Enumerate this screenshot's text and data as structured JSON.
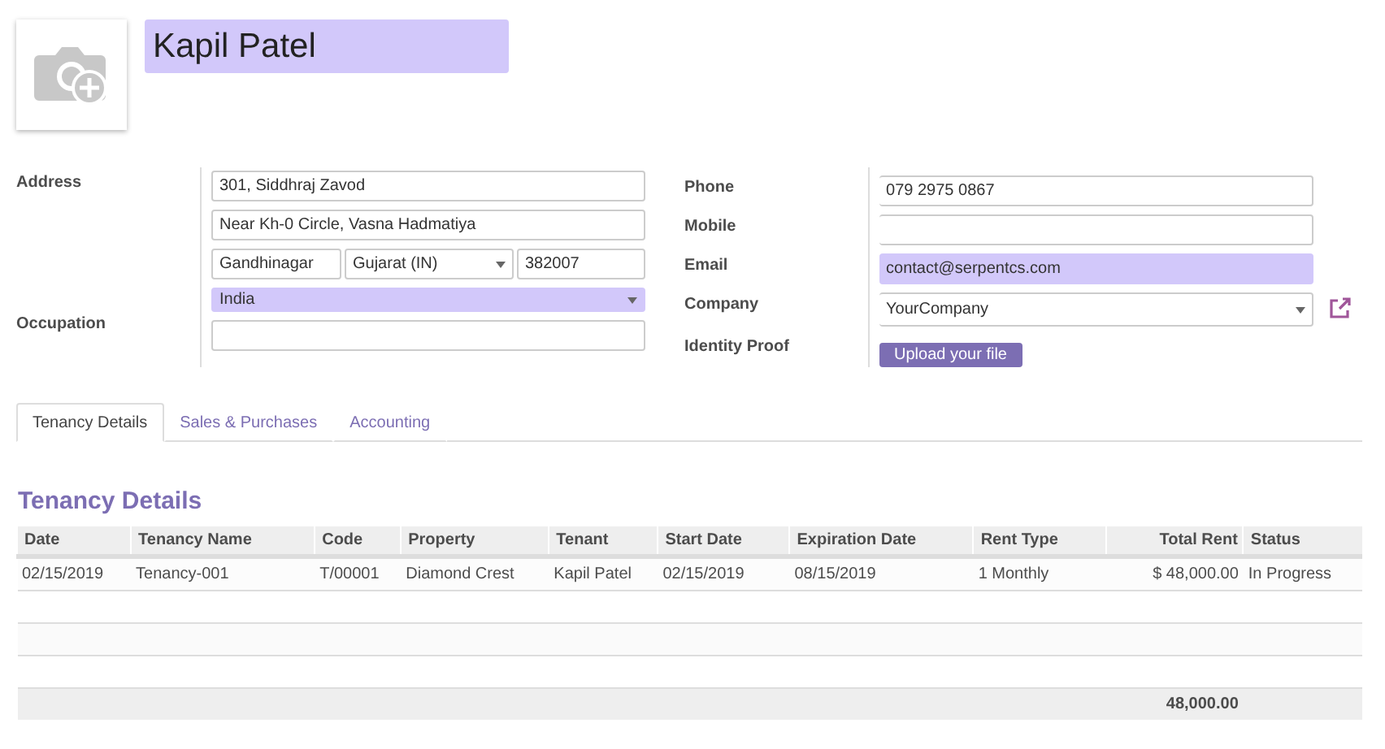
{
  "name_field": {
    "value": "Kapil Patel",
    "required": true
  },
  "left_group": {
    "address": {
      "label": "Address",
      "street": {
        "value": "301, Siddhraj Zavod",
        "required": false
      },
      "street2": {
        "value": "Near Kh-0 Circle, Vasna Hadmatiya",
        "required": false
      },
      "city": {
        "value": "Gandhinagar",
        "required": false
      },
      "state": {
        "value": "Gujarat (IN)",
        "required": false
      },
      "zip": {
        "value": "382007",
        "required": false
      },
      "country": {
        "value": "India",
        "required": true
      }
    },
    "occupation": {
      "label": "Occupation",
      "required": false
    }
  },
  "right_group": [
    {
      "kind": "input",
      "label": "Phone",
      "value": "079 2975 0867",
      "required": false
    },
    {
      "kind": "input",
      "label": "Mobile",
      "required": false
    },
    {
      "kind": "input",
      "label": "Email",
      "value": "contact@serpentcs.com",
      "required": true
    },
    {
      "kind": "select",
      "label": "Company",
      "value": "YourCompany",
      "required": false
    },
    {
      "kind": "upload",
      "label": "Identity Proof",
      "button": "Upload your file"
    }
  ],
  "tabs": [
    {
      "label": "Tenancy Details",
      "selected": true
    },
    {
      "label": "Sales & Purchases",
      "selected": false
    },
    {
      "label": "Accounting",
      "selected": false
    }
  ],
  "section_title": "Tenancy Details",
  "table": {
    "columns": [
      "Date",
      "Tenancy Name",
      "Code",
      "Property",
      "Tenant",
      "Start Date",
      "Expiration Date",
      "Rent Type",
      "Total Rent",
      "Status"
    ],
    "rows": [
      [
        "02/15/2019",
        "Tenancy-001",
        "T/00001",
        "Diamond Crest",
        "Kapil Patel",
        "02/15/2019",
        "08/15/2019",
        "1 Monthly",
        "$ 48,000.00",
        "In Progress"
      ]
    ],
    "footer_total": "48,000.00"
  }
}
